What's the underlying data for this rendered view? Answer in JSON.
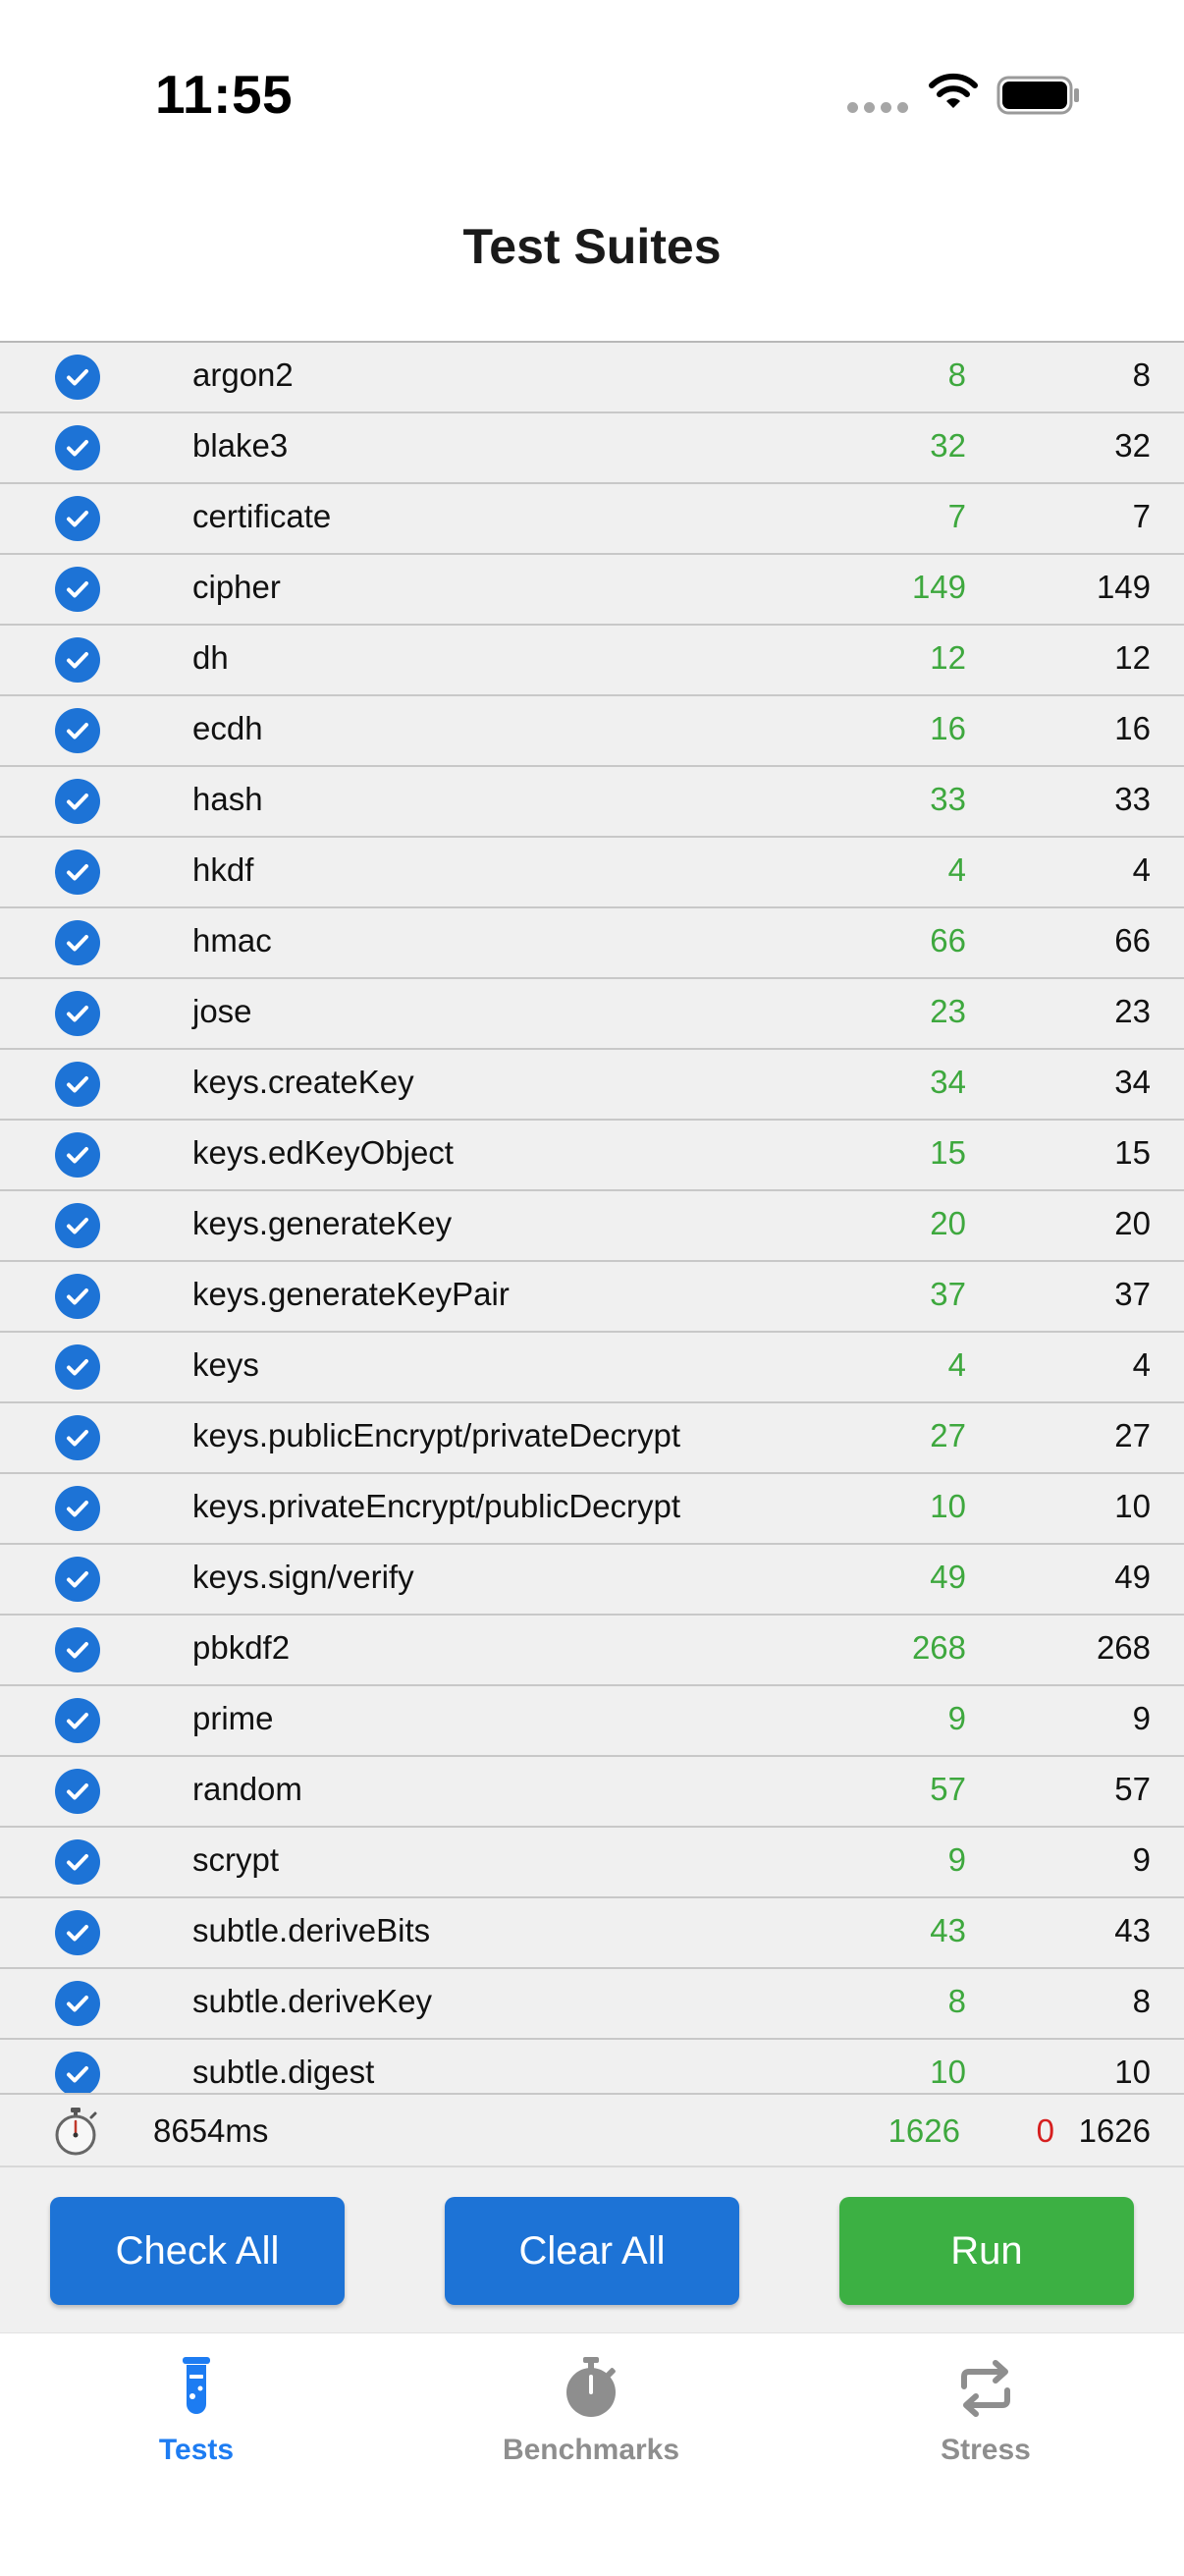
{
  "status_bar": {
    "time": "11:55"
  },
  "header": {
    "title": "Test Suites"
  },
  "suites": [
    {
      "name": "argon2",
      "passed": "8",
      "total": "8"
    },
    {
      "name": "blake3",
      "passed": "32",
      "total": "32"
    },
    {
      "name": "certificate",
      "passed": "7",
      "total": "7"
    },
    {
      "name": "cipher",
      "passed": "149",
      "total": "149"
    },
    {
      "name": "dh",
      "passed": "12",
      "total": "12"
    },
    {
      "name": "ecdh",
      "passed": "16",
      "total": "16"
    },
    {
      "name": "hash",
      "passed": "33",
      "total": "33"
    },
    {
      "name": "hkdf",
      "passed": "4",
      "total": "4"
    },
    {
      "name": "hmac",
      "passed": "66",
      "total": "66"
    },
    {
      "name": "jose",
      "passed": "23",
      "total": "23"
    },
    {
      "name": "keys.createKey",
      "passed": "34",
      "total": "34"
    },
    {
      "name": "keys.edKeyObject",
      "passed": "15",
      "total": "15"
    },
    {
      "name": "keys.generateKey",
      "passed": "20",
      "total": "20"
    },
    {
      "name": "keys.generateKeyPair",
      "passed": "37",
      "total": "37"
    },
    {
      "name": "keys",
      "passed": "4",
      "total": "4"
    },
    {
      "name": "keys.publicEncrypt/privateDecrypt",
      "passed": "27",
      "total": "27"
    },
    {
      "name": "keys.privateEncrypt/publicDecrypt",
      "passed": "10",
      "total": "10"
    },
    {
      "name": "keys.sign/verify",
      "passed": "49",
      "total": "49"
    },
    {
      "name": "pbkdf2",
      "passed": "268",
      "total": "268"
    },
    {
      "name": "prime",
      "passed": "9",
      "total": "9"
    },
    {
      "name": "random",
      "passed": "57",
      "total": "57"
    },
    {
      "name": "scrypt",
      "passed": "9",
      "total": "9"
    },
    {
      "name": "subtle.deriveBits",
      "passed": "43",
      "total": "43"
    },
    {
      "name": "subtle.deriveKey",
      "passed": "8",
      "total": "8"
    },
    {
      "name": "subtle.digest",
      "passed": "10",
      "total": "10"
    }
  ],
  "summary": {
    "duration": "8654ms",
    "passed": "1626",
    "failed": "0",
    "total": "1626"
  },
  "buttons": {
    "check_all": "Check All",
    "clear_all": "Clear All",
    "run": "Run"
  },
  "tabs": [
    {
      "label": "Tests",
      "icon": "test-tube-icon",
      "active": true
    },
    {
      "label": "Benchmarks",
      "icon": "stopwatch-icon",
      "active": false
    },
    {
      "label": "Stress",
      "icon": "repeat-icon",
      "active": false
    }
  ],
  "colors": {
    "accent": "#1d73d6",
    "pass": "#3ea83e",
    "fail": "#d61f1f",
    "run_button": "#3cb043",
    "active_tab": "#1d7cf2",
    "inactive_tab": "#8e8e8e",
    "row_background": "#f0f0f0"
  }
}
